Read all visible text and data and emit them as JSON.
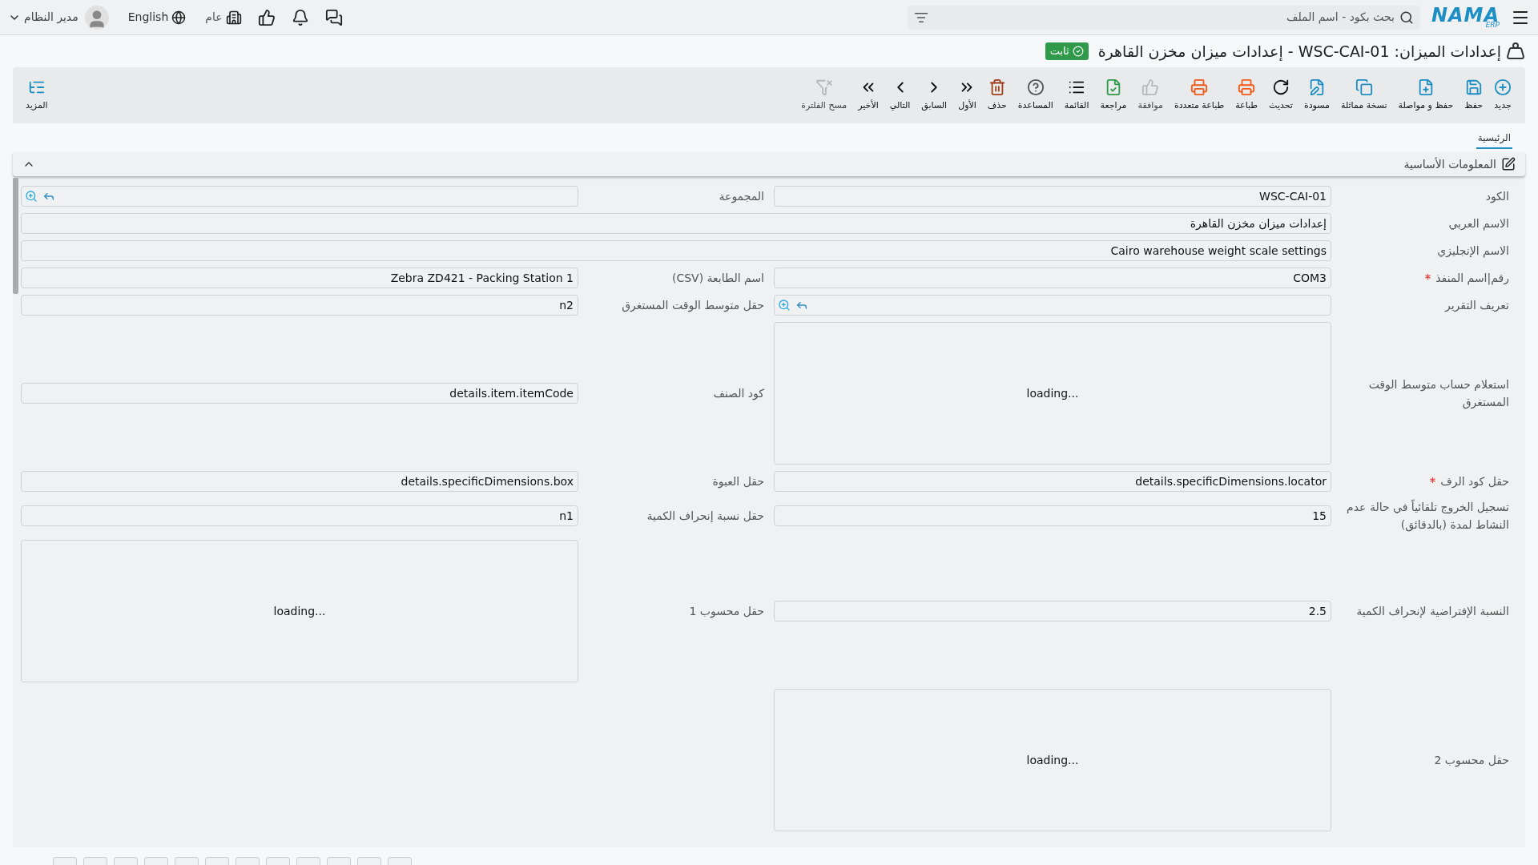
{
  "topbar": {
    "logo": {
      "text": "NAMA",
      "sub": "ERP"
    },
    "search": {
      "placeholder": "بحث بكود - اسم الملف"
    },
    "company": "عام",
    "language": "English",
    "user": "مدير النظام"
  },
  "title": {
    "text": "إعدادات الميزان: WSC-CAI-01 - إعدادات ميزان مخزن القاهرة",
    "status": "ثابت"
  },
  "toolbar": {
    "items": [
      {
        "label": "جديد",
        "color": "#1d8fc4",
        "disabled": false
      },
      {
        "label": "حفظ",
        "color": "#1d8fc4",
        "disabled": false
      },
      {
        "label": "حفظ و مواصلة",
        "color": "#1d8fc4",
        "disabled": false
      },
      {
        "label": "نسخة مماثلة",
        "color": "#1d8fc4",
        "disabled": false
      },
      {
        "label": "مسودة",
        "color": "#1d8fc4",
        "disabled": false
      },
      {
        "label": "تحديث",
        "color": "#111111",
        "disabled": false
      },
      {
        "label": "طباعة",
        "color": "#f05a1a",
        "disabled": false
      },
      {
        "label": "طباعة متعددة",
        "color": "#f05a1a",
        "disabled": false
      },
      {
        "label": "موافقة",
        "color": "#b8b8b8",
        "disabled": true
      },
      {
        "label": "مراجعة",
        "color": "#2e9a4a",
        "disabled": false
      },
      {
        "label": "القائمة",
        "color": "#111111",
        "disabled": false
      },
      {
        "label": "المساعدة",
        "color": "#555555",
        "disabled": false
      },
      {
        "label": "حذف",
        "color": "#a0401c",
        "disabled": false
      },
      {
        "label": "الأول",
        "color": "#111111",
        "disabled": false
      },
      {
        "label": "السابق",
        "color": "#111111",
        "disabled": false
      },
      {
        "label": "التالي",
        "color": "#111111",
        "disabled": false
      },
      {
        "label": "الأخير",
        "color": "#111111",
        "disabled": false
      },
      {
        "label": "مسح الفلترة",
        "color": "#b8b8b8",
        "disabled": true
      }
    ],
    "more": "المزيد"
  },
  "tabs": [
    {
      "label": "الرئيسية",
      "selected": true
    }
  ],
  "section": {
    "title": "المعلومات الأساسية",
    "expanded": true
  },
  "rows": [
    {
      "right": {
        "label": "الكود",
        "kind": "text",
        "value": "WSC-CAI-01",
        "required": false
      },
      "left": {
        "label": "المجموعة",
        "kind": "lookup",
        "required": false
      }
    },
    {
      "right": {
        "label": "الاسم العربي",
        "kind": "text",
        "value": "إعدادات ميزان مخزن القاهرة",
        "required": false,
        "full": true
      }
    },
    {
      "right": {
        "label": "الاسم الإنجليزي",
        "kind": "text",
        "value": "Cairo warehouse weight scale settings",
        "required": false,
        "full": true
      }
    },
    {
      "right": {
        "label": "رقم|اسم المنفذ",
        "kind": "text",
        "value": "COM3",
        "required": true
      },
      "left": {
        "label": "اسم الطابعة (CSV)",
        "kind": "text",
        "value": "Zebra ZD421 - Packing Station 1",
        "required": false
      }
    },
    {
      "right": {
        "label": "تعريف التقرير",
        "kind": "lookup",
        "required": false
      },
      "left": {
        "label": "حقل متوسط الوقت المستغرق",
        "kind": "text",
        "value": "n2",
        "required": false
      }
    },
    {
      "right": {
        "label": "استعلام حساب متوسط الوقت المستغرق",
        "kind": "textarea",
        "value": "loading...",
        "required": false
      },
      "left": {
        "label": "كود الصنف",
        "kind": "text",
        "value": "details.item.itemCode",
        "required": false
      }
    },
    {
      "right": {
        "label": "حقل كود الرف",
        "kind": "text",
        "value": "details.specificDimensions.locator",
        "required": true
      },
      "left": {
        "label": "حقل العبوة",
        "kind": "text",
        "value": "details.specificDimensions.box",
        "required": false
      }
    },
    {
      "right": {
        "label": "تسجيل الخروج تلقائياً في حالة عدم النشاط لمدة (بالدقائق)",
        "kind": "text",
        "value": "15",
        "required": false
      },
      "left": {
        "label": "حقل نسبة إنحراف الكمية",
        "kind": "text",
        "value": "n1",
        "required": false
      }
    },
    {
      "right": {
        "label": "النسبة الإفتراضية لإنحراف الكمية",
        "kind": "text",
        "value": "2.5",
        "required": false
      },
      "left": {
        "label": "حقل محسوب 1",
        "kind": "textarea",
        "value": "loading...",
        "required": false
      }
    },
    {
      "right": {
        "label": "حقل محسوب 2",
        "kind": "textarea",
        "value": "loading...",
        "required": false
      }
    }
  ]
}
